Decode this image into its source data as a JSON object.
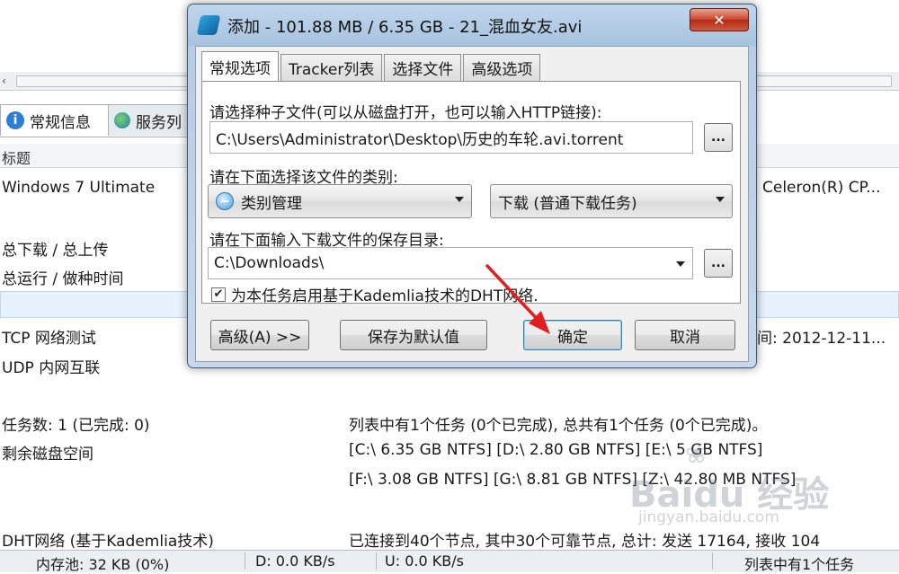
{
  "background": {
    "tabs": [
      {
        "label": "常规信息",
        "icon": "info-icon"
      },
      {
        "label": "服务列"
      }
    ],
    "column_header": "标题",
    "rows": [
      {
        "label": "Windows 7 Ultimate",
        "value": "Celeron(R) CP..."
      },
      {
        "label": "总下载 / 总上传",
        "value": ""
      },
      {
        "label": "总运行 / 做种时间",
        "value": ""
      },
      {
        "label": "TCP 网络测试",
        "value": "间: 2012-12-11..."
      },
      {
        "label": "UDP 内网互联",
        "value": ""
      },
      {
        "label": "任务数: 1 (已完成: 0)",
        "value": "列表中有1个任务 (0个已完成), 总共有1个任务 (0个已完成)。"
      },
      {
        "label": "剩余磁盘空间",
        "value": "[C:\\ 6.35 GB  NTFS]  [D:\\ 2.80 GB  NTFS]  [E:\\ 5 GB  NTFS]"
      },
      {
        "label": "",
        "value": "[F:\\ 3.08 GB  NTFS]  [G:\\ 8.81 GB  NTFS]  [Z:\\ 42.80 MB  NTFS]"
      },
      {
        "label": "DHT网络 (基于Kademlia技术)",
        "value": "已连接到40个节点, 其中30个可靠节点, 总计: 发送 17164, 接收 104"
      }
    ],
    "status": {
      "memory": "内存池: 32 KB (0%)",
      "download": "D: 0.0 KB/s",
      "upload": "U: 0.0 KB/s",
      "tasks": "列表中有1个任务"
    },
    "watermark": {
      "text": "Baidu 经验",
      "url": "jingyan.baidu.com"
    }
  },
  "dialog": {
    "title": "添加 - 101.88 MB / 6.35 GB - 21_混血女友.avi",
    "close_label": "✕",
    "tabs": [
      "常规选项",
      "Tracker列表",
      "选择文件",
      "高级选项"
    ],
    "torrent_label": "请选择种子文件(可以从磁盘打开，也可以输入HTTP链接):",
    "torrent_value": "C:\\Users\\Administrator\\Desktop\\历史的车轮.avi.torrent",
    "category_label": "请在下面选择该文件的类别:",
    "category_value": "类别管理",
    "download_type_value": "下载 (普通下载任务)",
    "save_dir_label": "请在下面输入下载文件的保存目录:",
    "save_dir_value": "C:\\Downloads\\",
    "browse_label": "...",
    "dht_checkbox_label": "为本任务启用基于Kademlia技术的DHT网络.",
    "dht_checked": true,
    "buttons": {
      "advanced": "高级(A) >>",
      "save_default": "保存为默认值",
      "ok": "确定",
      "cancel": "取消"
    }
  },
  "colors": {
    "annotation_arrow": "#e02020",
    "close_button": "#c6452d"
  }
}
